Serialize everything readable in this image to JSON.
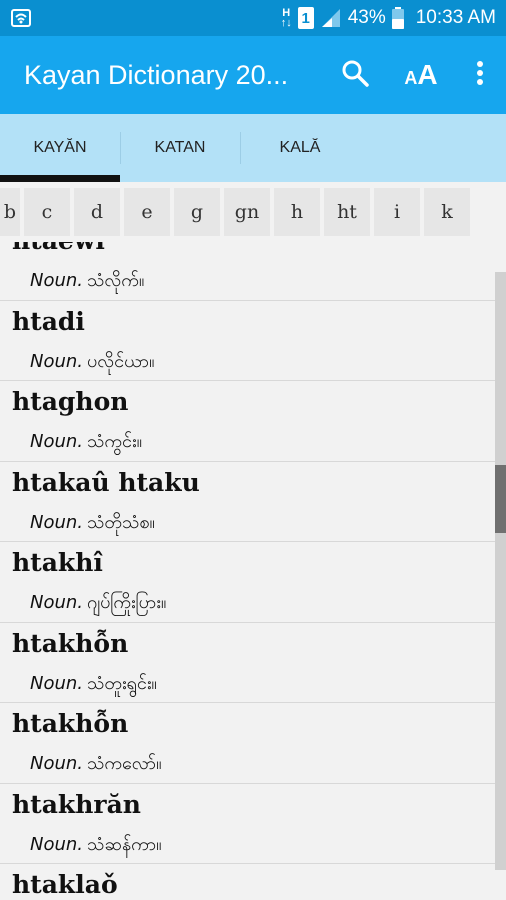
{
  "status_bar": {
    "network": "H",
    "sim": "1",
    "battery": "43%",
    "time": "10:33 AM"
  },
  "app_bar": {
    "title": "Kayan Dictionary 20...",
    "icons": [
      "search-icon",
      "font-size-icon",
      "overflow-menu-icon"
    ],
    "colors": {
      "status": "#0a8fd0",
      "toolbar": "#16a6ee",
      "tabs": "#b3e1f7"
    }
  },
  "tabs": [
    {
      "label": "KAYĂN",
      "active": true
    },
    {
      "label": "KATAN",
      "active": false
    },
    {
      "label": "KALĂ",
      "active": false
    }
  ],
  "alphabet": [
    "b",
    "c",
    "d",
    "e",
    "g",
    "gn",
    "h",
    "ht",
    "i",
    "k"
  ],
  "entries": [
    {
      "word": "htaewi",
      "pos": "Noun.",
      "gloss": "သံလိုက်။"
    },
    {
      "word": "htadi",
      "pos": "Noun.",
      "gloss": "ပလိုင်ယာ။"
    },
    {
      "word": "htaghon",
      "pos": "Noun.",
      "gloss": "သံကွင်း။"
    },
    {
      "word": "htakaû htaku",
      "pos": "Noun.",
      "gloss": "သံတိုသံစ။"
    },
    {
      "word": "htakhî",
      "pos": "Noun.",
      "gloss": "ဂျပ်ကြိုးပြား။"
    },
    {
      "word": "htakhỗn",
      "pos": "Noun.",
      "gloss": "သံတူးရွင်း။"
    },
    {
      "word": "htakhỗn",
      "pos": "Noun.",
      "gloss": "သံကလော်။"
    },
    {
      "word": "htakhrăn",
      "pos": "Noun.",
      "gloss": "သံဆန်ကာ။"
    },
    {
      "word": "htaklaǒ",
      "pos": "",
      "gloss": ""
    }
  ]
}
